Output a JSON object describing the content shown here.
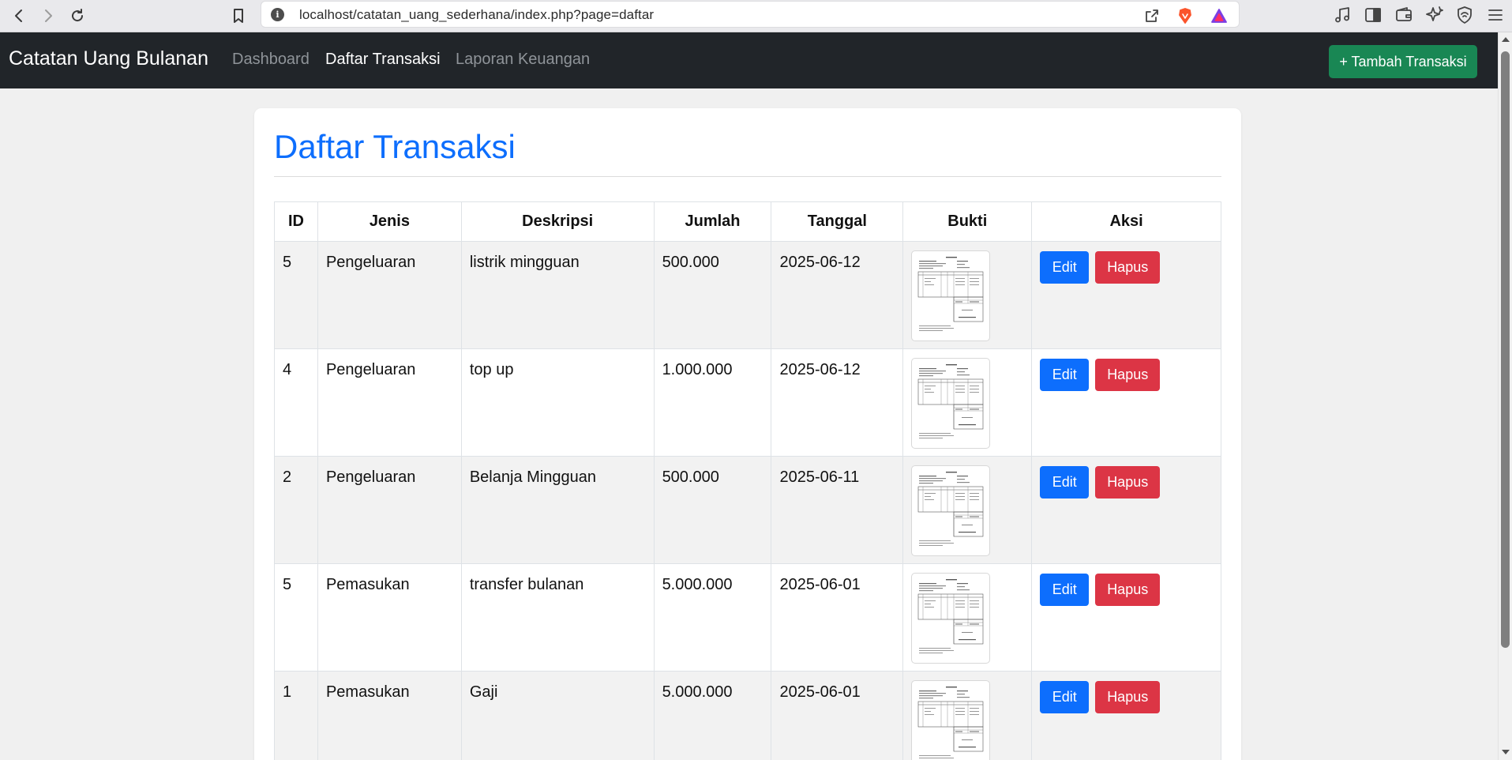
{
  "browser": {
    "url": "localhost/catatan_uang_sederhana/index.php?page=daftar"
  },
  "navbar": {
    "brand": "Catatan Uang Bulanan",
    "links": [
      {
        "label": "Dashboard",
        "active": false
      },
      {
        "label": "Daftar Transaksi",
        "active": true
      },
      {
        "label": "Laporan Keuangan",
        "active": false
      }
    ],
    "add_button": "+ Tambah Transaksi"
  },
  "page": {
    "title": "Daftar Transaksi"
  },
  "table": {
    "headers": [
      "ID",
      "Jenis",
      "Deskripsi",
      "Jumlah",
      "Tanggal",
      "Bukti",
      "Aksi"
    ],
    "rows": [
      {
        "id": "5",
        "jenis": "Pengeluaran",
        "deskripsi": "listrik mingguan",
        "jumlah": "500.000",
        "tanggal": "2025-06-12"
      },
      {
        "id": "4",
        "jenis": "Pengeluaran",
        "deskripsi": "top up",
        "jumlah": "1.000.000",
        "tanggal": "2025-06-12"
      },
      {
        "id": "2",
        "jenis": "Pengeluaran",
        "deskripsi": "Belanja Mingguan",
        "jumlah": "500.000",
        "tanggal": "2025-06-11"
      },
      {
        "id": "5",
        "jenis": "Pemasukan",
        "deskripsi": "transfer bulanan",
        "jumlah": "5.000.000",
        "tanggal": "2025-06-01"
      },
      {
        "id": "1",
        "jenis": "Pemasukan",
        "deskripsi": "Gaji",
        "jumlah": "5.000.000",
        "tanggal": "2025-06-01"
      }
    ],
    "edit_label": "Edit",
    "delete_label": "Hapus"
  },
  "colors": {
    "navbar_bg": "#212529",
    "title": "#0d6efd",
    "add_button": "#198754",
    "edit_button": "#0d6efd",
    "delete_button": "#dc3545"
  }
}
